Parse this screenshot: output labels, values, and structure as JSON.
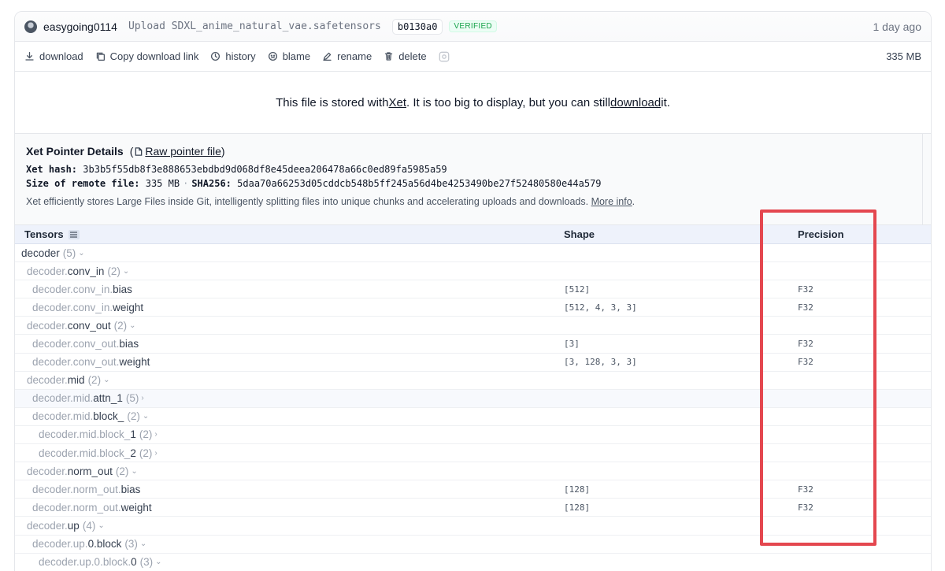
{
  "commit": {
    "username": "easygoing0114",
    "message": "Upload SDXL_anime_natural_vae.safetensors",
    "sha": "b0130a0",
    "verified_label": "VERIFIED",
    "time": "1 day ago"
  },
  "actions": {
    "download": "download",
    "copy_link": "Copy download link",
    "history": "history",
    "blame": "blame",
    "rename": "rename",
    "delete": "delete",
    "file_size": "335 MB"
  },
  "notice": {
    "prefix": "This file is stored with ",
    "xet_link": "Xet",
    "middle": " . It is too big to display, but you can still ",
    "download_link": "download",
    "suffix": " it."
  },
  "xet": {
    "title": "Xet Pointer Details",
    "raw_link": "Raw pointer file",
    "hash_label": "Xet hash:",
    "hash_value": "3b3b5f55db8f3e888653ebdbd9d068df8e45deea206478a66c0ed89fa5985a59",
    "size_label": "Size of remote file:",
    "size_value": "335 MB",
    "sha_label": "SHA256:",
    "sha_value": "5daa70a66253d05cddcb548b5ff245a56d4be4253490be27f52480580e44a579",
    "description": "Xet efficiently stores Large Files inside Git, intelligently splitting files into unique chunks and accelerating uploads and downloads.",
    "more_info": "More info",
    "dot": "."
  },
  "table": {
    "col_tensors": "Tensors",
    "col_shape": "Shape",
    "col_precision": "Precision",
    "rows": [
      {
        "prefix": "",
        "leaf": "decoder",
        "count": "(5)",
        "chev": "⌄",
        "shape": "",
        "precision": "",
        "indent": 0
      },
      {
        "prefix": "decoder.",
        "leaf": "conv_in",
        "count": "(2)",
        "chev": "⌄",
        "shape": "",
        "precision": "",
        "indent": 1
      },
      {
        "prefix": "decoder.conv_in.",
        "leaf": "bias",
        "count": "",
        "chev": "",
        "shape": "[512]",
        "precision": "F32",
        "indent": 2
      },
      {
        "prefix": "decoder.conv_in.",
        "leaf": "weight",
        "count": "",
        "chev": "",
        "shape": "[512, 4, 3, 3]",
        "precision": "F32",
        "indent": 2
      },
      {
        "prefix": "decoder.",
        "leaf": "conv_out",
        "count": "(2)",
        "chev": "⌄",
        "shape": "",
        "precision": "",
        "indent": 1
      },
      {
        "prefix": "decoder.conv_out.",
        "leaf": "bias",
        "count": "",
        "chev": "",
        "shape": "[3]",
        "precision": "F32",
        "indent": 2
      },
      {
        "prefix": "decoder.conv_out.",
        "leaf": "weight",
        "count": "",
        "chev": "",
        "shape": "[3, 128, 3, 3]",
        "precision": "F32",
        "indent": 2
      },
      {
        "prefix": "decoder.",
        "leaf": "mid",
        "count": "(2)",
        "chev": "⌄",
        "shape": "",
        "precision": "",
        "indent": 1
      },
      {
        "prefix": "decoder.mid.",
        "leaf": "attn_1",
        "count": "(5)",
        "chev": "›",
        "shape": "",
        "precision": "",
        "indent": 2
      },
      {
        "prefix": "decoder.mid.",
        "leaf": "block_",
        "count": "(2)",
        "chev": "⌄",
        "shape": "",
        "precision": "",
        "indent": 2
      },
      {
        "prefix": "decoder.mid.block_",
        "leaf": "1",
        "count": "(2)",
        "chev": "›",
        "shape": "",
        "precision": "",
        "indent": 3
      },
      {
        "prefix": "decoder.mid.block_",
        "leaf": "2",
        "count": "(2)",
        "chev": "›",
        "shape": "",
        "precision": "",
        "indent": 3
      },
      {
        "prefix": "decoder.",
        "leaf": "norm_out",
        "count": "(2)",
        "chev": "⌄",
        "shape": "",
        "precision": "",
        "indent": 1
      },
      {
        "prefix": "decoder.norm_out.",
        "leaf": "bias",
        "count": "",
        "chev": "",
        "shape": "[128]",
        "precision": "F32",
        "indent": 2
      },
      {
        "prefix": "decoder.norm_out.",
        "leaf": "weight",
        "count": "",
        "chev": "",
        "shape": "[128]",
        "precision": "F32",
        "indent": 2
      },
      {
        "prefix": "decoder.",
        "leaf": "up",
        "count": "(4)",
        "chev": "⌄",
        "shape": "",
        "precision": "",
        "indent": 1
      },
      {
        "prefix": "decoder.up.",
        "leaf": "0.block",
        "count": "(3)",
        "chev": "⌄",
        "shape": "",
        "precision": "",
        "indent": 2
      },
      {
        "prefix": "decoder.up.0.block.",
        "leaf": "0",
        "count": "(3)",
        "chev": "⌄",
        "shape": "",
        "precision": "",
        "indent": 3
      }
    ]
  },
  "colors": {
    "annotation": "#e4474f",
    "verified": "#16a34a",
    "header_bg": "#eef2fb"
  }
}
